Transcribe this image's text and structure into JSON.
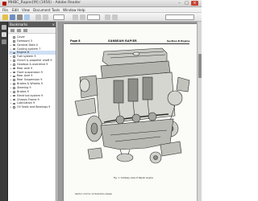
{
  "window": {
    "title": "MHBC_Rapier[M] (1956) - Adobe Reader",
    "min_label": "–",
    "max_label": "□",
    "close_label": "×"
  },
  "menu": [
    "File",
    "Edit",
    "View",
    "Document",
    "Tools",
    "Window",
    "Help"
  ],
  "bookmarks": {
    "title": "Bookmarks",
    "close_label": "×",
    "items": [
      {
        "label": "Cover",
        "toggle": "",
        "selected": false
      },
      {
        "label": "Foreword 3",
        "toggle": "",
        "selected": false
      },
      {
        "label": "General Data 4",
        "toggle": "+",
        "selected": false
      },
      {
        "label": "Cooling system 7",
        "toggle": "+",
        "selected": false
      },
      {
        "label": "Engine 8",
        "toggle": "+",
        "selected": true
      },
      {
        "label": "Fuel system 9",
        "toggle": "+",
        "selected": false
      },
      {
        "label": "Clutch & propeller shaft 9",
        "toggle": "+",
        "selected": false
      },
      {
        "label": "Gearbox & overdrive 9",
        "toggle": "+",
        "selected": false
      },
      {
        "label": "Rear axle 9",
        "toggle": "+",
        "selected": false
      },
      {
        "label": "Front suspension 9",
        "toggle": "+",
        "selected": false
      },
      {
        "label": "Rear Axle 9",
        "toggle": "+",
        "selected": false
      },
      {
        "label": "Rear Suspension 9",
        "toggle": "+",
        "selected": false
      },
      {
        "label": "Brakes & Wheels 9",
        "toggle": "+",
        "selected": false
      },
      {
        "label": "Steering 9",
        "toggle": "+",
        "selected": false
      },
      {
        "label": "Brakes 9",
        "toggle": "+",
        "selected": false
      },
      {
        "label": "Electrical system 9",
        "toggle": "+",
        "selected": false
      },
      {
        "label": "Chassis Frame 9",
        "toggle": "+",
        "selected": false
      },
      {
        "label": "Lubrication 9",
        "toggle": "+",
        "selected": false
      },
      {
        "label": "Oil Seals and Bearings 9",
        "toggle": "+",
        "selected": false
      }
    ]
  },
  "page": {
    "number": "Page 8",
    "heading": "SUNBEAM RAPIER",
    "section": "Section B  Engine",
    "caption": "Fig. 1. Cutaway view of Rapier engine",
    "footer": "Section of error at illustration please"
  }
}
